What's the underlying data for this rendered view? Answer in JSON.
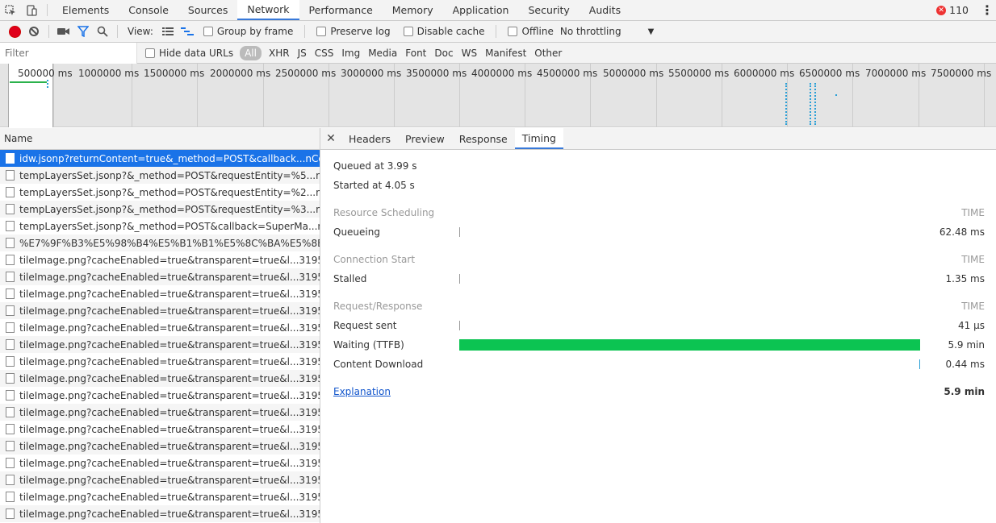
{
  "tabs": [
    "Elements",
    "Console",
    "Sources",
    "Network",
    "Performance",
    "Memory",
    "Application",
    "Security",
    "Audits"
  ],
  "error_count": "110",
  "toolbar": {
    "view_label": "View:",
    "group_by_frame": "Group by frame",
    "preserve_log": "Preserve log",
    "disable_cache": "Disable cache",
    "offline": "Offline",
    "throttling": "No throttling"
  },
  "filter": {
    "placeholder": "Filter",
    "hide_data_urls": "Hide data URLs",
    "types": [
      "All",
      "XHR",
      "JS",
      "CSS",
      "Img",
      "Media",
      "Font",
      "Doc",
      "WS",
      "Manifest",
      "Other"
    ]
  },
  "overview": {
    "ticks": [
      "500000 ms",
      "1000000 ms",
      "1500000 ms",
      "2000000 ms",
      "2500000 ms",
      "3000000 ms",
      "3500000 ms",
      "4000000 ms",
      "4500000 ms",
      "5000000 ms",
      "5500000 ms",
      "6000000 ms",
      "6500000 ms",
      "7000000 ms",
      "7500000 ms"
    ]
  },
  "requests": {
    "header": "Name",
    "rows": [
      "idw.jsonp?returnContent=true&_method=POST&callback...nCount...",
      "tempLayersSet.jsonp?&_method=POST&requestEntity=%5...nCount...",
      "tempLayersSet.jsonp?&_method=POST&requestEntity=%2...nCount...",
      "tempLayersSet.jsonp?&_method=POST&requestEntity=%3...nCount...",
      "tempLayersSet.jsonp?&_method=POST&callback=SuperMa...nCoun...",
      "%E7%9F%B3%E5%98%B4%E5%B1%B1%E5%8C%BA%E5%8E%BF.js...",
      "tileImage.png?cacheEnabled=true&transparent=true&l...31953219...",
      "tileImage.png?cacheEnabled=true&transparent=true&l...31953219...",
      "tileImage.png?cacheEnabled=true&transparent=true&l...31953219...",
      "tileImage.png?cacheEnabled=true&transparent=true&l...31953219...",
      "tileImage.png?cacheEnabled=true&transparent=true&l...31953219...",
      "tileImage.png?cacheEnabled=true&transparent=true&l...31953219...",
      "tileImage.png?cacheEnabled=true&transparent=true&l...31953219...",
      "tileImage.png?cacheEnabled=true&transparent=true&l...31953219...",
      "tileImage.png?cacheEnabled=true&transparent=true&l...31953219...",
      "tileImage.png?cacheEnabled=true&transparent=true&l...31953219...",
      "tileImage.png?cacheEnabled=true&transparent=true&l...31953219...",
      "tileImage.png?cacheEnabled=true&transparent=true&l...31953219...",
      "tileImage.png?cacheEnabled=true&transparent=true&l...31953219...",
      "tileImage.png?cacheEnabled=true&transparent=true&l...31953219...",
      "tileImage.png?cacheEnabled=true&transparent=true&l...31953219...",
      "tileImage.png?cacheEnabled=true&transparent=true&l...31953219..."
    ]
  },
  "detail": {
    "tabs": [
      "Headers",
      "Preview",
      "Response",
      "Timing"
    ],
    "queued": "Queued at 3.99 s",
    "started": "Started at 4.05 s",
    "time_label": "TIME",
    "sections": {
      "resource_scheduling": "Resource Scheduling",
      "connection_start": "Connection Start",
      "request_response": "Request/Response"
    },
    "rows": {
      "queueing": {
        "name": "Queueing",
        "value": "62.48 ms"
      },
      "stalled": {
        "name": "Stalled",
        "value": "1.35 ms"
      },
      "request_sent": {
        "name": "Request sent",
        "value": "41 µs"
      },
      "waiting": {
        "name": "Waiting (TTFB)",
        "value": "5.9 min"
      },
      "content_download": {
        "name": "Content Download",
        "value": "0.44 ms"
      }
    },
    "explanation": "Explanation",
    "total": "5.9 min"
  },
  "colors": {
    "accent": "#3879d9",
    "selected_row": "#1a73e8",
    "waiting_bar": "#0cc452",
    "download_bar": "#2a9fd6",
    "record": "#e0001b"
  }
}
